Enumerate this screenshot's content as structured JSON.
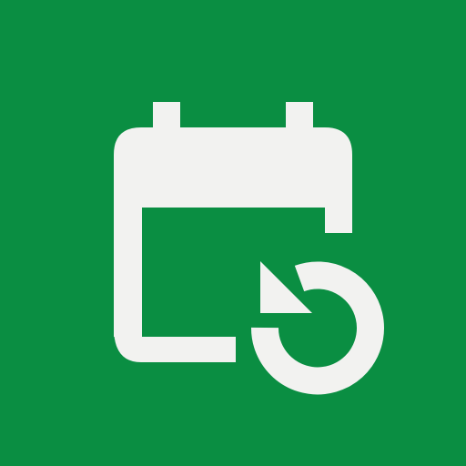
{
  "app_icon": {
    "icon_name": "calendar-history-icon",
    "background_color": "#0A8E42",
    "foreground_color": "#F2F2F0"
  }
}
